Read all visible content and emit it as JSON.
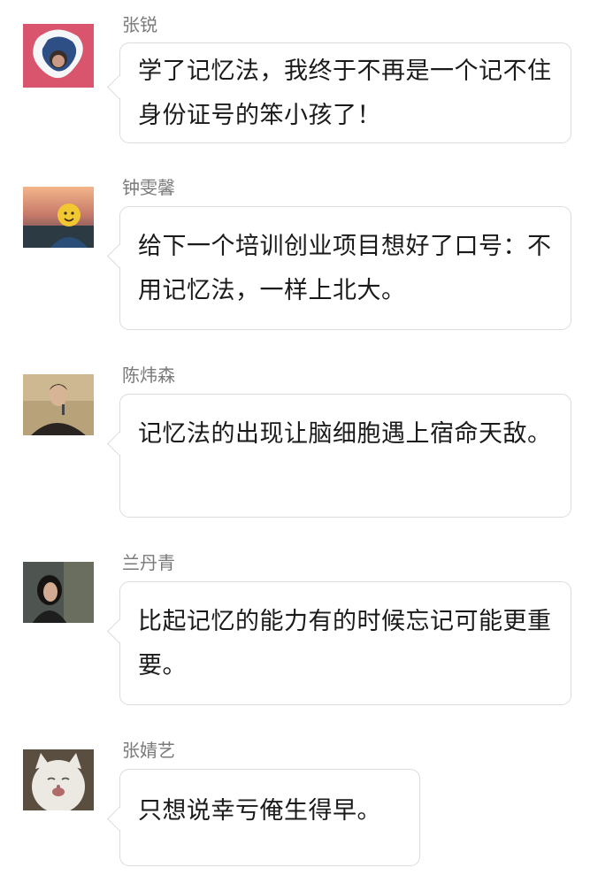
{
  "comments": [
    {
      "name": "张锐",
      "text": "学了记忆法，我终于不再是一个记不住身份证号的笨小孩了！"
    },
    {
      "name": "钟雯馨",
      "text": "给下一个培训创业项目想好了口号：不用记忆法，一样上北大。"
    },
    {
      "name": "陈炜森",
      "text": "记忆法的出现让脑细胞遇上宿命天敌。"
    },
    {
      "name": "兰丹青",
      "text": "比起记忆的能力有的时候忘记可能更重要。"
    },
    {
      "name": "张婧艺",
      "text": "只想说幸亏俺生得早。"
    }
  ]
}
